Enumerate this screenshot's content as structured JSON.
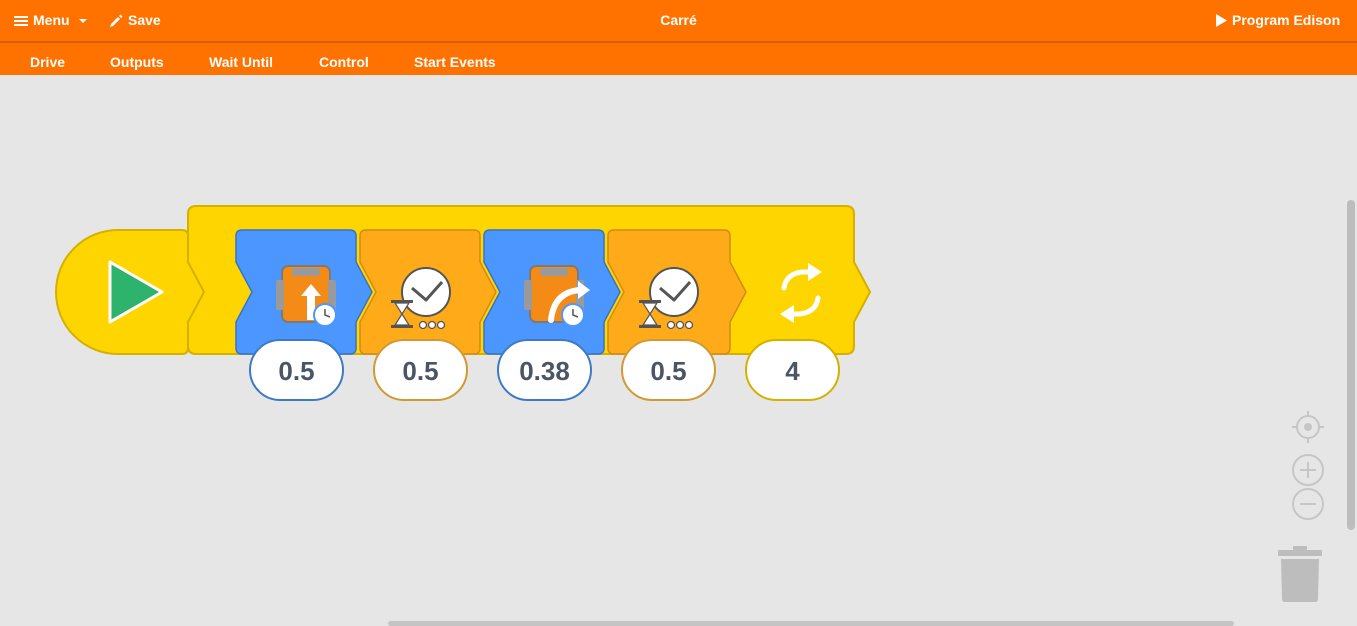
{
  "topbar": {
    "menu_label": "Menu",
    "save_label": "Save",
    "title": "Carré",
    "program_label": "Program Edison"
  },
  "categories": [
    {
      "label": "Drive"
    },
    {
      "label": "Outputs"
    },
    {
      "label": "Wait Until"
    },
    {
      "label": "Control"
    },
    {
      "label": "Start Events"
    }
  ],
  "program": {
    "start_block": {
      "icon": "play-icon"
    },
    "loop_block": {
      "icon": "repeat-arrows-icon",
      "count": "4"
    },
    "blocks": [
      {
        "type": "drive-forward-seconds",
        "icon": "robot-forward-timer-icon",
        "value": "0.5"
      },
      {
        "type": "wait-seconds",
        "icon": "hourglass-clock-icon",
        "value": "0.5"
      },
      {
        "type": "turn-right-seconds",
        "icon": "robot-turn-timer-icon",
        "value": "0.38"
      },
      {
        "type": "wait-seconds",
        "icon": "hourglass-clock-icon",
        "value": "0.5"
      }
    ]
  },
  "colors": {
    "header": "#ff7200",
    "canvas": "#e6e6e6",
    "loop_yellow": "#ffd500",
    "drive_blue": "#4c97ff",
    "wait_orange": "#ffab19",
    "start_green": "#2db36b",
    "value_text": "#4c5566"
  }
}
